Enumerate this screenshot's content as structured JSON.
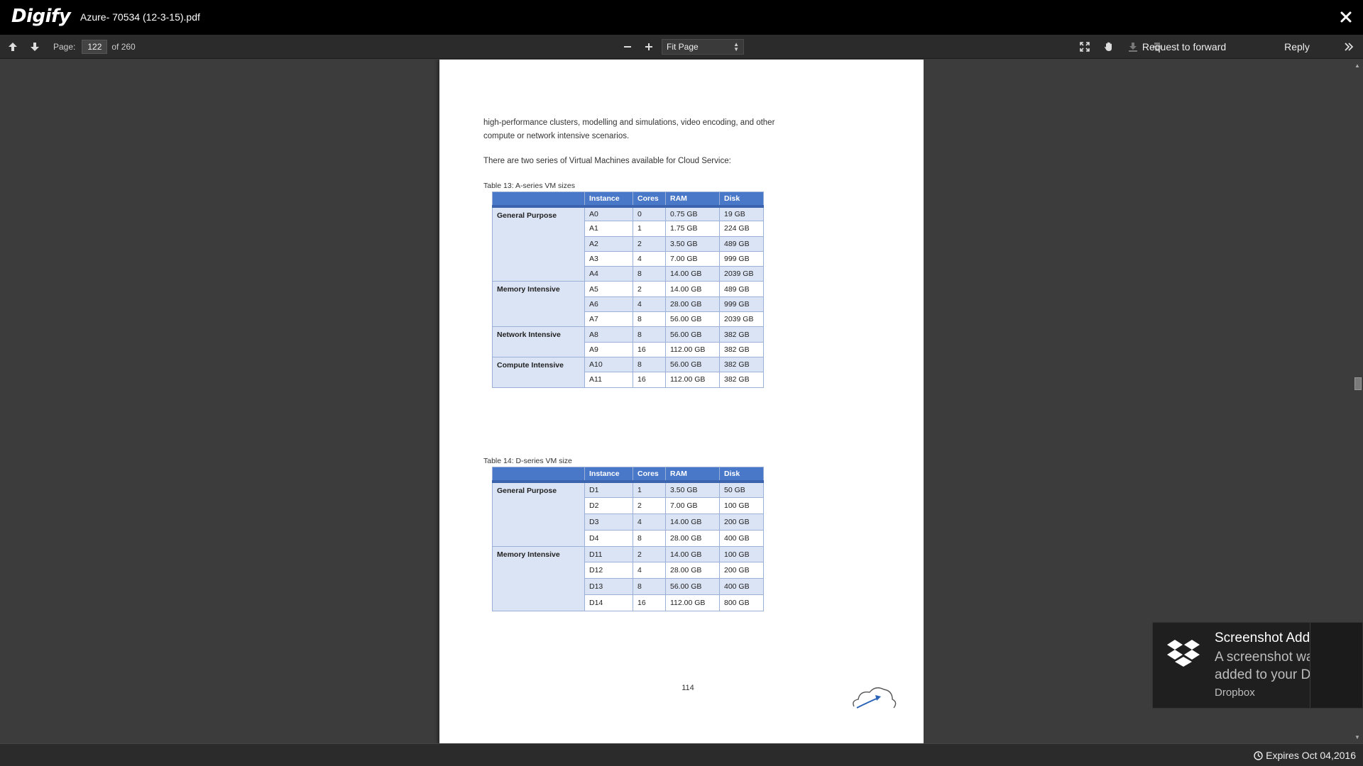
{
  "app": {
    "name": "Digify",
    "file_name": "Azure- 70534 (12-3-15).pdf"
  },
  "toolbar": {
    "page_label": "Page:",
    "current_page": "122",
    "total_pages": "of 260",
    "zoom_value": "Fit Page",
    "request_forward_label": "Request to forward",
    "reply_label": "Reply"
  },
  "document": {
    "para1_line1": "high-performance clusters, modelling and simulations, video encoding, and other",
    "para1_line2": "compute or network intensive scenarios.",
    "para2": "There are two series of Virtual Machines available for Cloud Service:",
    "table13_caption": "Table 13: A-series VM sizes",
    "table14_caption": "Table 14: D-series VM size",
    "headers": [
      "",
      "Instance",
      "Cores",
      "RAM",
      "Disk"
    ],
    "table13_rows": [
      {
        "group": "General Purpose",
        "instance": "A0",
        "cores": "0",
        "ram": "0.75 GB",
        "disk": "19 GB"
      },
      {
        "group": "",
        "instance": "A1",
        "cores": "1",
        "ram": "1.75 GB",
        "disk": "224 GB"
      },
      {
        "group": "",
        "instance": "A2",
        "cores": "2",
        "ram": "3.50 GB",
        "disk": "489 GB"
      },
      {
        "group": "",
        "instance": "A3",
        "cores": "4",
        "ram": "7.00 GB",
        "disk": "999 GB"
      },
      {
        "group": "",
        "instance": "A4",
        "cores": "8",
        "ram": "14.00 GB",
        "disk": "2039 GB"
      },
      {
        "group": "Memory Intensive",
        "instance": "A5",
        "cores": "2",
        "ram": "14.00 GB",
        "disk": "489 GB"
      },
      {
        "group": "",
        "instance": "A6",
        "cores": "4",
        "ram": "28.00 GB",
        "disk": "999 GB"
      },
      {
        "group": "",
        "instance": "A7",
        "cores": "8",
        "ram": "56.00 GB",
        "disk": "2039 GB"
      },
      {
        "group": "Network Intensive",
        "instance": "A8",
        "cores": "8",
        "ram": "56.00 GB",
        "disk": "382 GB"
      },
      {
        "group": "",
        "instance": "A9",
        "cores": "16",
        "ram": "112.00 GB",
        "disk": "382 GB"
      },
      {
        "group": "Compute Intensive",
        "instance": "A10",
        "cores": "8",
        "ram": "56.00 GB",
        "disk": "382 GB"
      },
      {
        "group": "",
        "instance": "A11",
        "cores": "16",
        "ram": "112.00 GB",
        "disk": "382 GB"
      }
    ],
    "table14_rows": [
      {
        "group": "General Purpose",
        "instance": "D1",
        "cores": "1",
        "ram": "3.50 GB",
        "disk": "50 GB"
      },
      {
        "group": "",
        "instance": "D2",
        "cores": "2",
        "ram": "7.00 GB",
        "disk": "100 GB"
      },
      {
        "group": "",
        "instance": "D3",
        "cores": "4",
        "ram": "14.00 GB",
        "disk": "200 GB"
      },
      {
        "group": "",
        "instance": "D4",
        "cores": "8",
        "ram": "28.00 GB",
        "disk": "400 GB"
      },
      {
        "group": "Memory Intensive",
        "instance": "D11",
        "cores": "2",
        "ram": "14.00 GB",
        "disk": "100 GB"
      },
      {
        "group": "",
        "instance": "D12",
        "cores": "4",
        "ram": "28.00 GB",
        "disk": "200 GB"
      },
      {
        "group": "",
        "instance": "D13",
        "cores": "8",
        "ram": "56.00 GB",
        "disk": "400 GB"
      },
      {
        "group": "",
        "instance": "D14",
        "cores": "16",
        "ram": "112.00 GB",
        "disk": "800 GB"
      }
    ],
    "page_number": "114"
  },
  "toast": {
    "title": "Screenshot Added",
    "message": "A screenshot was added to your Dropbox.",
    "source": "Dropbox"
  },
  "status": {
    "expires": "Expires Oct 04,2016"
  },
  "colors": {
    "table_header": "#4a78c8",
    "table_alt_row": "#dbe4f4",
    "page_background": "#3c3c3c",
    "toolbar_background": "#2b2b2b"
  },
  "icons": [
    "close-icon",
    "arrow-up-icon",
    "arrow-down-icon",
    "zoom-out-icon",
    "zoom-in-icon",
    "fullscreen-icon",
    "hand-icon",
    "download-icon",
    "print-icon",
    "forward-icon",
    "reply-icon",
    "expand-icon",
    "dropbox-icon",
    "clock-icon",
    "cloud-logo-icon"
  ]
}
